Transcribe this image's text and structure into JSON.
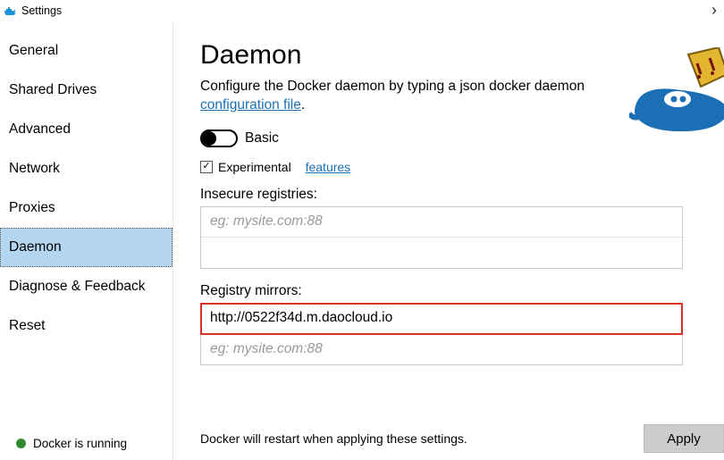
{
  "titlebar": {
    "title": "Settings"
  },
  "sidebar": {
    "items": [
      {
        "label": "General"
      },
      {
        "label": "Shared Drives"
      },
      {
        "label": "Advanced"
      },
      {
        "label": "Network"
      },
      {
        "label": "Proxies"
      },
      {
        "label": "Daemon"
      },
      {
        "label": "Diagnose & Feedback"
      },
      {
        "label": "Reset"
      }
    ],
    "selected_index": 5,
    "status_text": "Docker is running"
  },
  "main": {
    "heading": "Daemon",
    "desc_prefix": "Configure the Docker daemon by typing a json docker daemon ",
    "desc_link": "configuration file",
    "desc_suffix": ".",
    "toggle_label": "Basic",
    "experimental_label": "Experimental",
    "experimental_link": "features",
    "insecure_label": "Insecure registries:",
    "insecure_placeholder": "eg: mysite.com:88",
    "mirrors_label": "Registry mirrors:",
    "mirrors_value": "http://0522f34d.m.daocloud.io",
    "mirrors_placeholder": "eg: mysite.com:88",
    "footer_text": "Docker will restart when applying these settings.",
    "apply_label": "Apply"
  }
}
